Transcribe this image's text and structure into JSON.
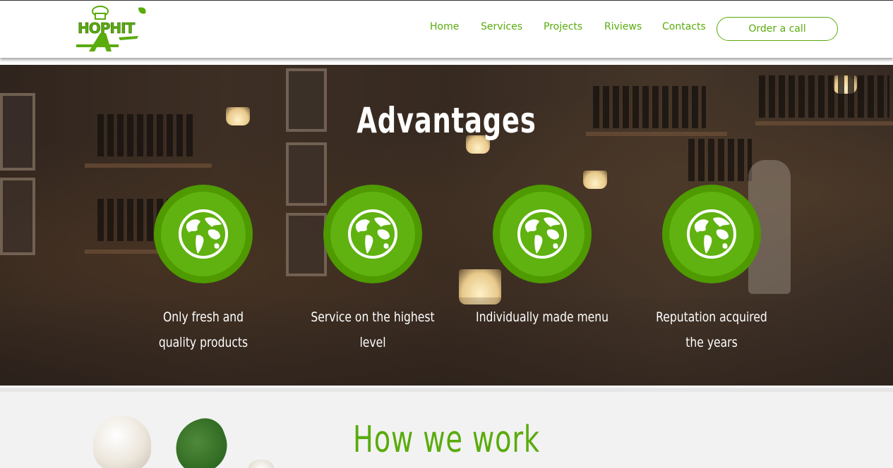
{
  "header": {
    "logo_text": "HOPHIT",
    "nav": [
      {
        "label": "Home"
      },
      {
        "label": "Services"
      },
      {
        "label": "Projects"
      },
      {
        "label": "Riviews"
      },
      {
        "label": "Contacts"
      }
    ],
    "order_button": "Order a call"
  },
  "advantages": {
    "title": "Advantages",
    "items": [
      {
        "text": "Only fresh and quality products",
        "icon": "globe-icon"
      },
      {
        "text": "Service on the highest level",
        "icon": "globe-icon"
      },
      {
        "text": "Individually made menu",
        "icon": "globe-icon"
      },
      {
        "text": "Reputation acquired the years",
        "icon": "globe-icon"
      }
    ]
  },
  "how_we_work": {
    "title": "How we work"
  },
  "colors": {
    "brand_green": "#5aab0c",
    "circle_outer": "#4e9a00",
    "circle_inner": "#5fb20f"
  }
}
